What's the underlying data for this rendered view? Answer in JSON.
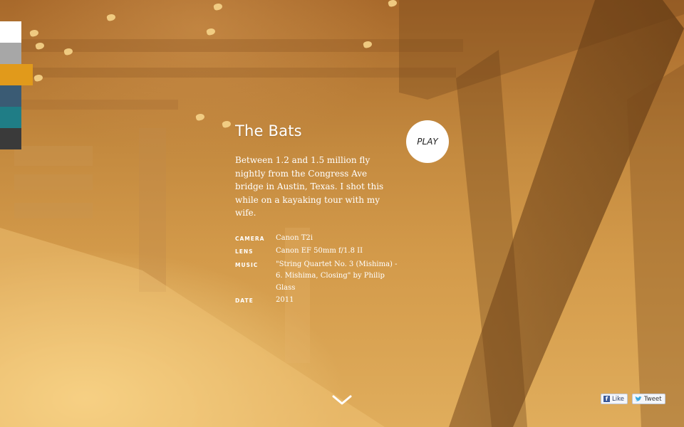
{
  "colors": {
    "swatches": [
      "#ffffff",
      "#a7a7a7",
      "#e19a1b",
      "#3a5b74",
      "#1f7d86",
      "#3a3a3a"
    ],
    "accent": "#ffffff"
  },
  "story": {
    "title": "The Bats",
    "description": "Between 1.2 and 1.5 million fly nightly from the Congress Ave bridge in Austin, Texas. I shot this while on a kayaking tour with my wife.",
    "meta": [
      {
        "key": "CAMERA",
        "value": "Canon T2i"
      },
      {
        "key": "LENS",
        "value": "Canon EF 50mm f/1.8 II"
      },
      {
        "key": "MUSIC",
        "value": "\"String Quartet No. 3 (Mishima) - 6. Mishima, Closing\" by Philip Glass"
      },
      {
        "key": "DATE",
        "value": "2011"
      }
    ]
  },
  "controls": {
    "play_label": "PLAY",
    "scroll_icon": "chevron-down-icon"
  },
  "social": {
    "like_label": "Like",
    "tweet_label": "Tweet",
    "like_icon": "facebook-icon",
    "tweet_icon": "twitter-icon"
  }
}
